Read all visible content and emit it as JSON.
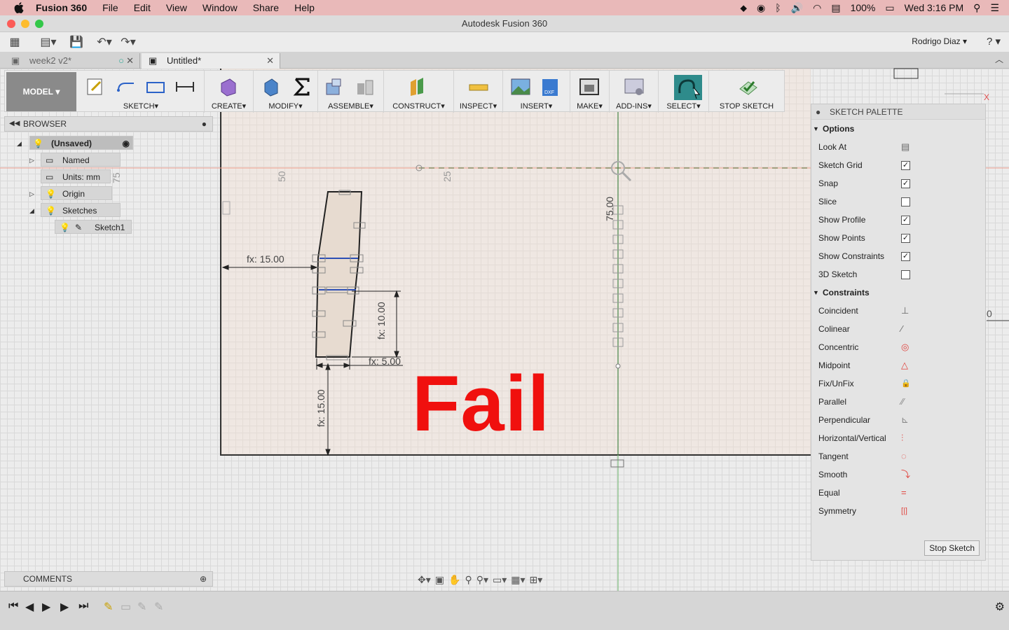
{
  "menubar": {
    "app": "Fusion 360",
    "items": [
      "File",
      "Edit",
      "View",
      "Window",
      "Share",
      "Help"
    ],
    "battery": "100%",
    "clock": "Wed 3:16 PM"
  },
  "window": {
    "title": "Autodesk Fusion 360"
  },
  "quickbar": {
    "user": "Rodrigo Diaz",
    "help": "?"
  },
  "tabs": [
    {
      "label": "week2 v2*"
    },
    {
      "label": "Untitled*"
    }
  ],
  "ribbon": {
    "model": "MODEL",
    "groups": [
      "SKETCH",
      "CREATE",
      "MODIFY",
      "ASSEMBLE",
      "CONSTRUCT",
      "INSPECT",
      "INSERT",
      "MAKE",
      "ADD-INS",
      "SELECT",
      "STOP SKETCH"
    ]
  },
  "browser": {
    "title": "BROWSER",
    "nodes": {
      "root": "(Unsaved)",
      "named_views": "Named Views",
      "units": "Units: mm",
      "origin": "Origin",
      "sketches": "Sketches",
      "sketch1": "Sketch1"
    }
  },
  "comments": {
    "title": "COMMENTS"
  },
  "sketch": {
    "dims": {
      "d_fx15_h": "fx: 15.00",
      "d_fx10": "fx: 10.00",
      "d_fx5": "fx: 5.00",
      "d_fx15_v": "fx: 15.00",
      "d_75": "75.00",
      "d_50": "50",
      "d_25": "25",
      "d_75b": "75",
      "d_0": "0"
    },
    "overlay_text": "Fail"
  },
  "palette": {
    "title": "SKETCH PALETTE",
    "options_header": "Options",
    "options": [
      {
        "label": "Look At",
        "type": "icon"
      },
      {
        "label": "Sketch Grid",
        "checked": true
      },
      {
        "label": "Snap",
        "checked": true
      },
      {
        "label": "Slice",
        "checked": false
      },
      {
        "label": "Show Profile",
        "checked": true
      },
      {
        "label": "Show Points",
        "checked": true
      },
      {
        "label": "Show Constraints",
        "checked": true
      },
      {
        "label": "3D Sketch",
        "checked": false
      }
    ],
    "constraints_header": "Constraints",
    "constraints": [
      {
        "label": "Coincident",
        "glyph": "⊥",
        "color": "#666666"
      },
      {
        "label": "Colinear",
        "glyph": "⁄",
        "color": "#666666"
      },
      {
        "label": "Concentric",
        "glyph": "◎",
        "color": "#e0443e"
      },
      {
        "label": "Midpoint",
        "glyph": "△",
        "color": "#e0443e"
      },
      {
        "label": "Fix/UnFix",
        "glyph": "🔒",
        "color": "#e0443e"
      },
      {
        "label": "Parallel",
        "glyph": "∕∕",
        "color": "#888888"
      },
      {
        "label": "Perpendicular",
        "glyph": "⊾",
        "color": "#888888"
      },
      {
        "label": "Horizontal/Vertical",
        "glyph": "⫶",
        "color": "#e0443e"
      },
      {
        "label": "Tangent",
        "glyph": "◌",
        "color": "#e0443e"
      },
      {
        "label": "Smooth",
        "glyph": "⤵",
        "color": "#e0443e"
      },
      {
        "label": "Equal",
        "glyph": "=",
        "color": "#e0443e"
      },
      {
        "label": "Symmetry",
        "glyph": "[|]",
        "color": "#e0443e"
      }
    ],
    "stop_button": "Stop Sketch"
  },
  "colors": {
    "fail": "#f0100e",
    "accent_select": "#2e8b8b",
    "menubar": "#e9b9b9"
  }
}
